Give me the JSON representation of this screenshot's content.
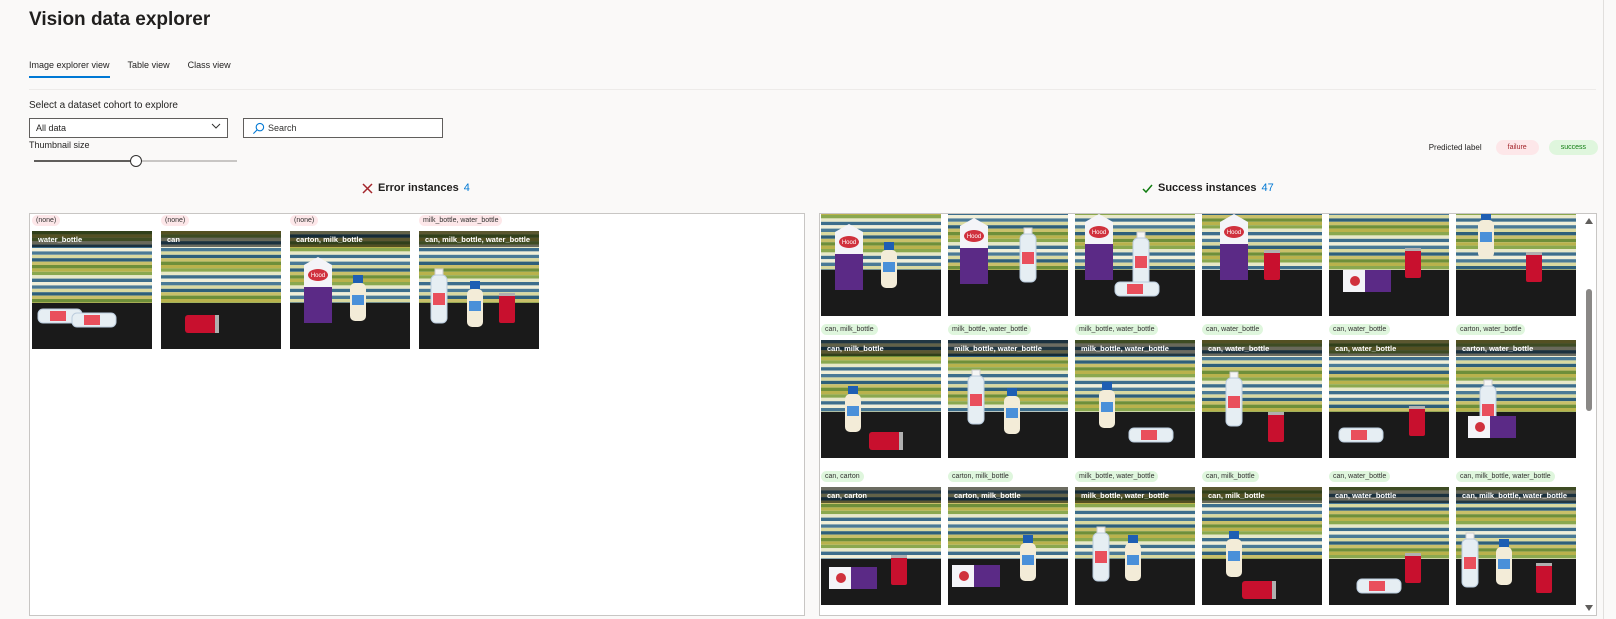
{
  "app": {
    "title": "Vision data explorer"
  },
  "tabs": [
    {
      "label": "Image explorer view",
      "active": true
    },
    {
      "label": "Table view",
      "active": false
    },
    {
      "label": "Class view",
      "active": false
    }
  ],
  "cohort": {
    "label": "Select a dataset cohort to explore",
    "selected": "All data"
  },
  "search": {
    "placeholder": "Search"
  },
  "thumbnail": {
    "label": "Thumbnail size",
    "value": 0.5
  },
  "legend": {
    "label": "Predicted label",
    "failure": "failure",
    "success": "success"
  },
  "errors": {
    "title": "Error instances",
    "count": "4",
    "items": [
      {
        "tag": "(none)",
        "caption": "water_bottle",
        "scene": "bottle_lying"
      },
      {
        "tag": "(none)",
        "caption": "can",
        "scene": "can_lying"
      },
      {
        "tag": "(none)",
        "caption": "carton, milk_bottle",
        "scene": "carton_milk"
      },
      {
        "tag": "milk_bottle, water_bottle",
        "caption": "can, milk_bottle, water_bottle",
        "scene": "three"
      }
    ]
  },
  "successes": {
    "title": "Success instances",
    "count": "47",
    "rows": [
      [
        {
          "tag": "",
          "caption": "",
          "scene": "carton_milk"
        },
        {
          "tag": "",
          "caption": "",
          "scene": "carton_water"
        },
        {
          "tag": "",
          "caption": "",
          "scene": "carton_lying_water"
        },
        {
          "tag": "",
          "caption": "",
          "scene": "carton_can"
        },
        {
          "tag": "",
          "caption": "",
          "scene": "carton_lying_can"
        },
        {
          "tag": "",
          "caption": "",
          "scene": "milk_can"
        }
      ],
      [
        {
          "tag": "can, milk_bottle",
          "caption": "can, milk_bottle",
          "scene": "milk_can_lying"
        },
        {
          "tag": "milk_bottle, water_bottle",
          "caption": "milk_bottle, water_bottle",
          "scene": "water_milk"
        },
        {
          "tag": "milk_bottle, water_bottle",
          "caption": "milk_bottle, water_bottle",
          "scene": "milk_water_lying"
        },
        {
          "tag": "can, water_bottle",
          "caption": "can, water_bottle",
          "scene": "water_can"
        },
        {
          "tag": "can, water_bottle",
          "caption": "can, water_bottle",
          "scene": "can_water_lying"
        },
        {
          "tag": "carton, water_bottle",
          "caption": "carton, water_bottle",
          "scene": "carton_lying_water2"
        }
      ],
      [
        {
          "tag": "can, carton",
          "caption": "can, carton",
          "scene": "carton_lying_can2"
        },
        {
          "tag": "carton, milk_bottle",
          "caption": "carton, milk_bottle",
          "scene": "carton_lying_milk"
        },
        {
          "tag": "milk_bottle, water_bottle",
          "caption": "milk_bottle, water_bottle",
          "scene": "water_milk2"
        },
        {
          "tag": "can, milk_bottle",
          "caption": "can, milk_bottle",
          "scene": "milk_can_lying2"
        },
        {
          "tag": "can, water_bottle",
          "caption": "can, water_bottle",
          "scene": "can_water_lying2"
        },
        {
          "tag": "can, milk_bottle, water_bottle",
          "caption": "can, milk_bottle, water_bottle",
          "scene": "three2"
        }
      ]
    ]
  },
  "colors": {
    "accent": "#0078d4",
    "error": "#a4262c",
    "success": "#107c10",
    "failure_bg": "#fde7e9",
    "success_bg": "#dff6dd"
  },
  "icons": {
    "error": "x-icon",
    "success": "checkmark-icon",
    "search": "search-icon",
    "dropdown": "chevron-down-icon"
  }
}
